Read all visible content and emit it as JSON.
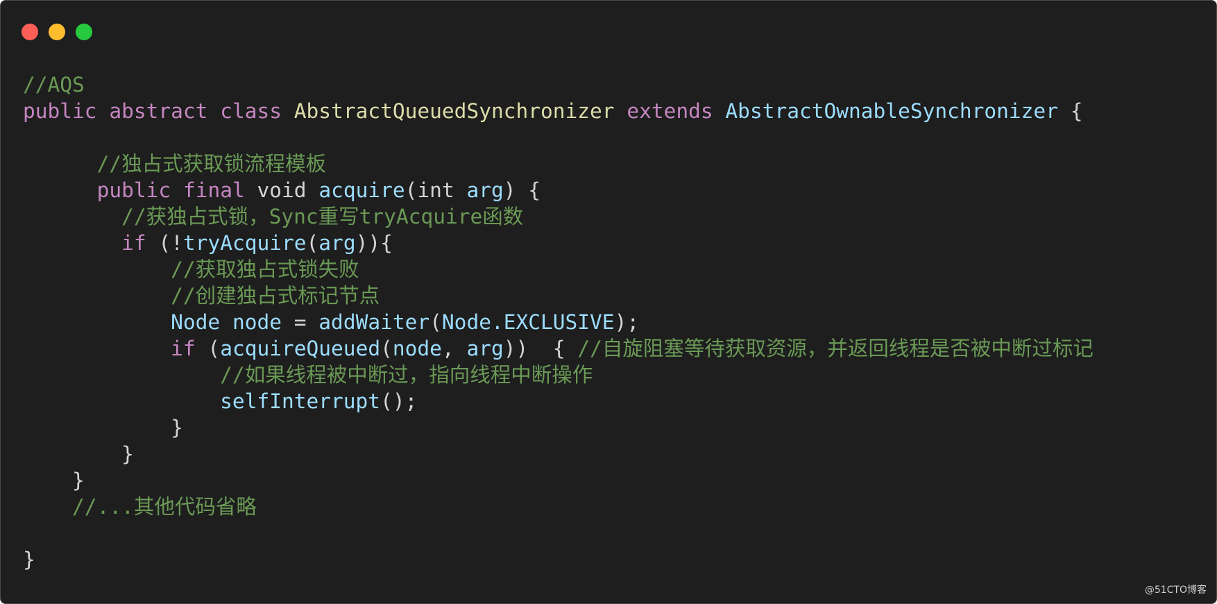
{
  "window": {
    "controls": [
      {
        "name": "close",
        "color": "#ff5f56"
      },
      {
        "name": "minimize",
        "color": "#ffbd2e"
      },
      {
        "name": "zoom",
        "color": "#27c93f"
      }
    ]
  },
  "code": {
    "lines": [
      [
        {
          "t": "comment",
          "s": "//AQS"
        }
      ],
      [
        {
          "t": "keyword",
          "s": "public"
        },
        {
          "t": "plain",
          "s": " "
        },
        {
          "t": "keyword",
          "s": "abstract"
        },
        {
          "t": "plain",
          "s": " "
        },
        {
          "t": "keyword",
          "s": "class"
        },
        {
          "t": "plain",
          "s": " "
        },
        {
          "t": "class",
          "s": "AbstractQueuedSynchronizer"
        },
        {
          "t": "plain",
          "s": " "
        },
        {
          "t": "keyword",
          "s": "extends"
        },
        {
          "t": "plain",
          "s": " "
        },
        {
          "t": "class2",
          "s": "AbstractOwnableSynchronizer"
        },
        {
          "t": "plain",
          "s": " {"
        }
      ],
      [
        {
          "t": "plain",
          "s": ""
        }
      ],
      [
        {
          "t": "plain",
          "s": "      "
        },
        {
          "t": "comment",
          "s": "//独占式获取锁流程模板"
        }
      ],
      [
        {
          "t": "plain",
          "s": "      "
        },
        {
          "t": "keyword",
          "s": "public"
        },
        {
          "t": "plain",
          "s": " "
        },
        {
          "t": "keyword",
          "s": "final"
        },
        {
          "t": "plain",
          "s": " void "
        },
        {
          "t": "func",
          "s": "acquire"
        },
        {
          "t": "plain",
          "s": "(int "
        },
        {
          "t": "var",
          "s": "arg"
        },
        {
          "t": "plain",
          "s": ") {"
        }
      ],
      [
        {
          "t": "plain",
          "s": "        "
        },
        {
          "t": "comment",
          "s": "//获独占式锁，Sync重写tryAcquire函数"
        }
      ],
      [
        {
          "t": "plain",
          "s": "        "
        },
        {
          "t": "keyword",
          "s": "if"
        },
        {
          "t": "plain",
          "s": " (!"
        },
        {
          "t": "func",
          "s": "tryAcquire"
        },
        {
          "t": "plain",
          "s": "("
        },
        {
          "t": "var",
          "s": "arg"
        },
        {
          "t": "plain",
          "s": ")){"
        }
      ],
      [
        {
          "t": "plain",
          "s": "            "
        },
        {
          "t": "comment",
          "s": "//获取独占式锁失败"
        }
      ],
      [
        {
          "t": "plain",
          "s": "            "
        },
        {
          "t": "comment",
          "s": "//创建独占式标记节点"
        }
      ],
      [
        {
          "t": "plain",
          "s": "            "
        },
        {
          "t": "var",
          "s": "Node"
        },
        {
          "t": "plain",
          "s": " "
        },
        {
          "t": "var",
          "s": "node"
        },
        {
          "t": "plain",
          "s": " = "
        },
        {
          "t": "func",
          "s": "addWaiter"
        },
        {
          "t": "plain",
          "s": "("
        },
        {
          "t": "var",
          "s": "Node.EXCLUSIVE"
        },
        {
          "t": "plain",
          "s": ");"
        }
      ],
      [
        {
          "t": "plain",
          "s": "            "
        },
        {
          "t": "keyword",
          "s": "if"
        },
        {
          "t": "plain",
          "s": " ("
        },
        {
          "t": "func",
          "s": "acquireQueued"
        },
        {
          "t": "plain",
          "s": "("
        },
        {
          "t": "var",
          "s": "node"
        },
        {
          "t": "plain",
          "s": ", "
        },
        {
          "t": "var",
          "s": "arg"
        },
        {
          "t": "plain",
          "s": "))  { "
        },
        {
          "t": "comment",
          "s": "//自旋阻塞等待获取资源，并返回线程是否被中断过标记"
        }
      ],
      [
        {
          "t": "plain",
          "s": "                "
        },
        {
          "t": "comment",
          "s": "//如果线程被中断过，指向线程中断操作"
        }
      ],
      [
        {
          "t": "plain",
          "s": "                "
        },
        {
          "t": "func",
          "s": "selfInterrupt"
        },
        {
          "t": "plain",
          "s": "();"
        }
      ],
      [
        {
          "t": "plain",
          "s": "            }"
        }
      ],
      [
        {
          "t": "plain",
          "s": "        }"
        }
      ],
      [
        {
          "t": "plain",
          "s": "    }"
        }
      ],
      [
        {
          "t": "plain",
          "s": "    "
        },
        {
          "t": "comment",
          "s": "//...其他代码省略"
        }
      ],
      [
        {
          "t": "plain",
          "s": ""
        }
      ],
      [
        {
          "t": "plain",
          "s": "}"
        }
      ]
    ]
  },
  "watermark": "@51CTO博客"
}
